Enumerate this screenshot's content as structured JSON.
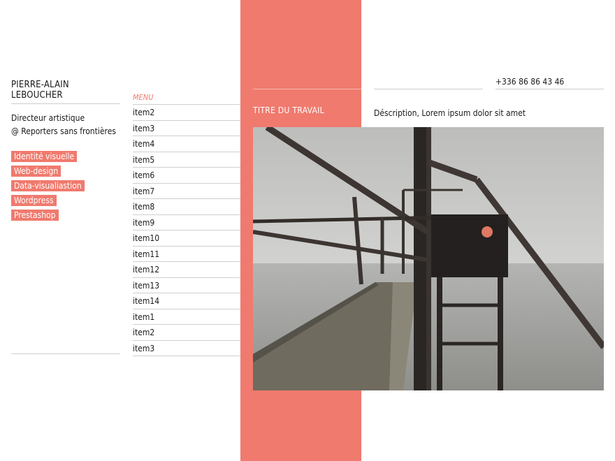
{
  "profile": {
    "name": "PIERRE-ALAIN LEBOUCHER",
    "role_line1": "Directeur artistique",
    "role_line2": "@ Reporters sans frontières"
  },
  "tags": [
    "Identité visuelle",
    "Web-design",
    "Data-visualiastion",
    "Wordpress",
    "Prestashop"
  ],
  "menu": {
    "heading": "MENU",
    "items": [
      "item2",
      "item3",
      "item4",
      "item5",
      "item6",
      "item7",
      "item8",
      "item9",
      "item10",
      "item11",
      "item12",
      "item13",
      "item14",
      "item1",
      "item2",
      "item3"
    ]
  },
  "work": {
    "title": "TITRE DU TRAVAIL",
    "description": "Déscription, Lorem ipsum dolor sit amet"
  },
  "contact": {
    "phone": "+336 86 86 43 46"
  },
  "colors": {
    "accent": "#f07a6e",
    "rule": "#cfcfcf"
  }
}
